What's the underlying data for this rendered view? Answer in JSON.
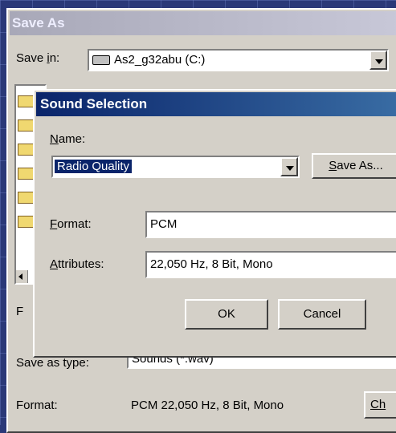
{
  "save_as": {
    "title": "Save As",
    "save_in_prefix": "Save ",
    "save_in_hotkey": "i",
    "save_in_suffix": "n:",
    "save_in_value": "As2_g32abu (C:)",
    "file_name_fragment": "F",
    "save_as_type_label": "Save as type:",
    "save_as_type_value": "Sounds (*.wav)",
    "format_label": "Format:",
    "format_value": "PCM 22,050 Hz, 8 Bit, Mono",
    "choose_button_fragment": "Ch"
  },
  "sound_selection": {
    "title": "Sound Selection",
    "name_hotkey": "N",
    "name_rest": "ame:",
    "name_value": "Radio Quality",
    "save_as_button_hotkey": "S",
    "save_as_button_rest": "ave As...",
    "format_hotkey": "F",
    "format_rest": "ormat:",
    "format_value": "PCM",
    "attributes_hotkey": "A",
    "attributes_rest": "ttributes:",
    "attributes_value": "22,050 Hz, 8 Bit, Mono",
    "ok_label": "OK",
    "cancel_label": "Cancel"
  },
  "colors": {
    "active_title": "#0a246a",
    "inactive_title": "#a8a8b8",
    "dialog_face": "#d4d0c8",
    "desktop": "#2a3878"
  }
}
